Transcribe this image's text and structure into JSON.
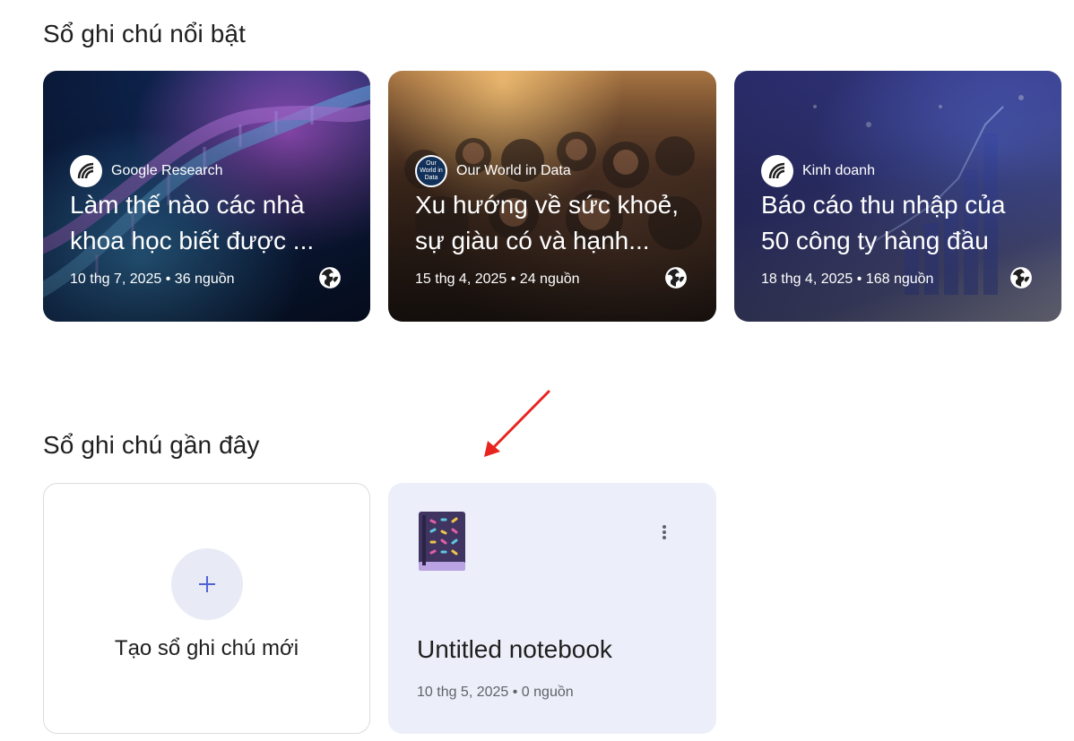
{
  "sections": {
    "featured_title": "Sổ ghi chú nổi bật",
    "recent_title": "Sổ ghi chú gần đây"
  },
  "featured": [
    {
      "source": "Google Research",
      "title": "Làm thế nào các nhà khoa học biết được ...",
      "meta": "10 thg 7, 2025 • 36 nguồn",
      "icon": "globe-icon"
    },
    {
      "source": "Our World in Data",
      "logo_text": "Our World in Data",
      "title": "Xu hướng về sức khoẻ, sự giàu có và hạnh...",
      "meta": "15 thg 4, 2025 • 24 nguồn",
      "icon": "globe-icon"
    },
    {
      "source": "Kinh doanh",
      "title": "Báo cáo thu nhập của 50 công ty hàng đầu",
      "meta": "18 thg 4, 2025 • 168 nguồn",
      "icon": "globe-icon"
    }
  ],
  "new_notebook": {
    "label": "Tạo sổ ghi chú mới",
    "icon": "plus-icon"
  },
  "recent": [
    {
      "title": "Untitled notebook",
      "meta": "10 thg 5, 2025 • 0 nguồn",
      "icon": "notebook-emoji-icon"
    }
  ],
  "colors": {
    "accent": "#4f63d9",
    "notebook_card_bg": "#eceef9",
    "plus_circle_bg": "#e8eaf6",
    "annotation_arrow": "#e8241f"
  }
}
